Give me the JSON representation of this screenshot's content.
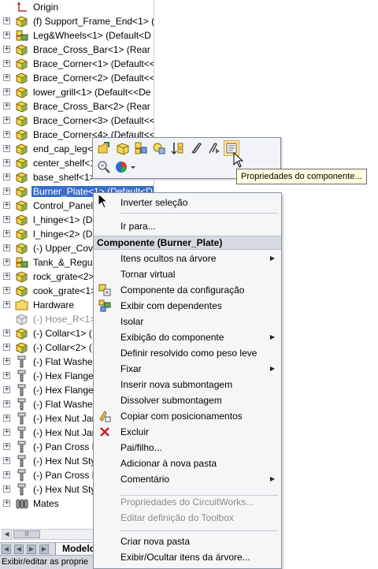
{
  "tree": {
    "items": [
      {
        "label": "Origin",
        "icon": "origin-icon",
        "expander": false,
        "dim": false
      },
      {
        "label": "(f) Support_Frame_End<1> (",
        "icon": "part-icon",
        "expander": true,
        "dim": false
      },
      {
        "label": "Leg&Wheels<1> (Default<D",
        "icon": "subassembly-icon",
        "expander": true,
        "dim": false
      },
      {
        "label": "Brace_Cross_Bar<1> (Rear Su",
        "icon": "part-icon",
        "expander": true,
        "dim": false
      },
      {
        "label": "Brace_Corner<1> (Default<<",
        "icon": "part-icon",
        "expander": true,
        "dim": false
      },
      {
        "label": "Brace_Corner<2> (Default<<",
        "icon": "part-icon",
        "expander": true,
        "dim": false
      },
      {
        "label": "lower_grill<1> (Default<<De",
        "icon": "part-icon",
        "expander": true,
        "dim": false
      },
      {
        "label": "Brace_Cross_Bar<2> (Rear Su",
        "icon": "part-icon",
        "expander": true,
        "dim": false
      },
      {
        "label": "Brace_Corner<3> (Default<<",
        "icon": "part-icon",
        "expander": true,
        "dim": false
      },
      {
        "label": "Brace_Corner<4> (Default<<",
        "icon": "part-icon",
        "expander": true,
        "dim": false
      },
      {
        "label": "end_cap_leg<",
        "icon": "part-icon",
        "expander": true,
        "dim": false
      },
      {
        "label": "center_shelf<1",
        "icon": "part-icon",
        "expander": true,
        "dim": false
      },
      {
        "label": "base_shelf<1>",
        "icon": "part-icon",
        "expander": true,
        "dim": false
      },
      {
        "label": "Burner_Plate<1> (Default<D",
        "icon": "part-icon",
        "expander": true,
        "dim": false,
        "selected": true
      },
      {
        "label": "Control_Panel",
        "icon": "part-icon",
        "expander": true,
        "dim": false
      },
      {
        "label": "l_hinge<1> (D",
        "icon": "part-icon",
        "expander": true,
        "dim": false
      },
      {
        "label": "l_hinge<2> (D",
        "icon": "part-icon",
        "expander": true,
        "dim": false
      },
      {
        "label": "(-) Upper_Cov",
        "icon": "part-icon",
        "expander": true,
        "dim": false
      },
      {
        "label": "Tank_&_Regul",
        "icon": "subassembly-icon",
        "expander": true,
        "dim": false
      },
      {
        "label": "rock_grate<2>",
        "icon": "part-icon",
        "expander": true,
        "dim": false
      },
      {
        "label": "cook_grate<1>",
        "icon": "part-icon",
        "expander": true,
        "dim": false
      },
      {
        "label": "Hardware",
        "icon": "folder-icon",
        "expander": true,
        "dim": false
      },
      {
        "label": "(-) Hose_R<1>",
        "icon": "suppressed-part-icon",
        "expander": false,
        "dim": true
      },
      {
        "label": "(-) Collar<1> (",
        "icon": "part-icon",
        "expander": true,
        "dim": false
      },
      {
        "label": "(-) Collar<2> (",
        "icon": "part-icon",
        "expander": true,
        "dim": false
      },
      {
        "label": "(-) Flat Washe",
        "icon": "toolbox-part-icon",
        "expander": true,
        "dim": false
      },
      {
        "label": "(-) Hex Flange",
        "icon": "toolbox-part-icon",
        "expander": true,
        "dim": false
      },
      {
        "label": "(-) Hex Flange",
        "icon": "toolbox-part-icon",
        "expander": true,
        "dim": false
      },
      {
        "label": "(-) Flat Washe",
        "icon": "toolbox-part-icon",
        "expander": true,
        "dim": false
      },
      {
        "label": "(-) Hex Nut Jar",
        "icon": "toolbox-part-icon",
        "expander": true,
        "dim": false
      },
      {
        "label": "(-) Hex Nut Jar",
        "icon": "toolbox-part-icon",
        "expander": true,
        "dim": false
      },
      {
        "label": "(-) Pan Cross H",
        "icon": "toolbox-part-icon",
        "expander": true,
        "dim": false
      },
      {
        "label": "(-) Hex Nut Sty",
        "icon": "toolbox-part-icon",
        "expander": true,
        "dim": false
      },
      {
        "label": "(-) Pan Cross H",
        "icon": "toolbox-part-icon",
        "expander": true,
        "dim": false
      },
      {
        "label": "(-) Hex Nut Sty",
        "icon": "toolbox-part-icon",
        "expander": true,
        "dim": false
      },
      {
        "label": "Mates",
        "icon": "mates-icon",
        "expander": true,
        "dim": false
      }
    ]
  },
  "bottom": {
    "tab_model": "Modelo",
    "status": "Exibir/editar as proprie"
  },
  "tooltip": {
    "text": "Propriedades do componente..."
  },
  "context_toolbar": {
    "buttons": [
      "open-part-icon",
      "edit-part-icon",
      "edit-assembly-icon",
      "hide-show-icon",
      "reorder-icon",
      "mate-icon",
      "smart-mate-icon",
      "component-properties-icon",
      "zoom-selection-icon",
      "appearance-icon"
    ]
  },
  "menu": {
    "invert_selection": "Inverter seleção",
    "goto": "Ir para...",
    "header": "Componente (Burner_Plate)",
    "items": [
      {
        "label": "Itens ocultos na árvore",
        "submenu": true,
        "icon": null,
        "disabled": false
      },
      {
        "label": "Tornar virtual",
        "submenu": false,
        "icon": null,
        "disabled": false
      },
      {
        "label": "Componente da configuração",
        "submenu": false,
        "icon": "config-component-icon",
        "disabled": false
      },
      {
        "label": "Exibir com dependentes",
        "submenu": false,
        "icon": "dependents-icon",
        "disabled": false
      },
      {
        "label": "Isolar",
        "submenu": false,
        "icon": null,
        "disabled": false
      },
      {
        "label": "Exibição do componente",
        "submenu": true,
        "icon": null,
        "disabled": false
      },
      {
        "label": "Definir resolvido como peso leve",
        "submenu": false,
        "icon": null,
        "disabled": false
      },
      {
        "label": "Fixar",
        "submenu": true,
        "icon": null,
        "disabled": false
      },
      {
        "label": "Inserir nova submontagem",
        "submenu": false,
        "icon": null,
        "disabled": false
      },
      {
        "label": "Dissolver submontagem",
        "submenu": false,
        "icon": null,
        "disabled": false
      },
      {
        "label": "Copiar com posicionamentos",
        "submenu": false,
        "icon": "copy-mates-icon",
        "disabled": false
      },
      {
        "label": "Excluir",
        "submenu": false,
        "icon": "delete-icon",
        "disabled": false
      },
      {
        "label": "Pai/filho...",
        "submenu": false,
        "icon": null,
        "disabled": false
      },
      {
        "label": "Adicionar à nova pasta",
        "submenu": false,
        "icon": null,
        "disabled": false
      },
      {
        "label": "Comentário",
        "submenu": true,
        "icon": null,
        "disabled": false
      }
    ],
    "items2": [
      {
        "label": "Propriedades do CircuitWorks...",
        "disabled": true
      },
      {
        "label": "Editar definição do Toolbox",
        "disabled": true
      }
    ],
    "items3": [
      {
        "label": "Criar nova pasta",
        "disabled": false
      },
      {
        "label": "Exibir/Ocultar itens da árvore...",
        "disabled": false
      }
    ]
  },
  "colors": {
    "selection": "#3a6ec8",
    "tooltip_bg": "#ffffe1",
    "menu_bg": "#f5f6f8",
    "header_bg": "#d5dae1"
  }
}
